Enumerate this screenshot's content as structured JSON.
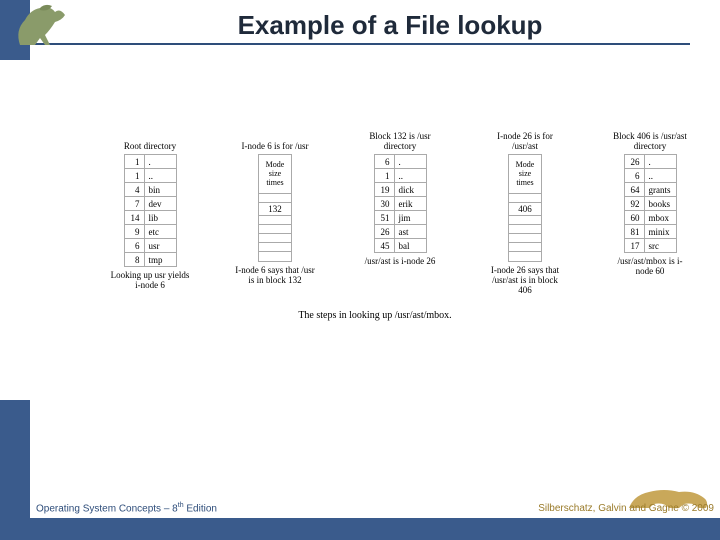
{
  "title": "Example of a File lookup",
  "footer_left_a": "Operating System Concepts – 8",
  "footer_left_sup": "th",
  "footer_left_b": " Edition",
  "footer_right": "Silberschatz, Galvin and Gagne © 2009",
  "columns": {
    "root": {
      "header": "Root directory",
      "rows": [
        {
          "n": "1",
          "name": "."
        },
        {
          "n": "1",
          "name": ".."
        },
        {
          "n": "4",
          "name": "bin"
        },
        {
          "n": "7",
          "name": "dev"
        },
        {
          "n": "14",
          "name": "lib"
        },
        {
          "n": "9",
          "name": "etc"
        },
        {
          "n": "6",
          "name": "usr"
        },
        {
          "n": "8",
          "name": "tmp"
        }
      ],
      "caption": "Looking up usr yields i-node 6"
    },
    "inode6": {
      "header": "I-node 6 is for /usr",
      "body": "Mode size times",
      "pointer": "132",
      "caption": "I-node 6 says that /usr is in block 132"
    },
    "block132": {
      "header": "Block 132 is /usr directory",
      "rows": [
        {
          "n": "6",
          "name": "."
        },
        {
          "n": "1",
          "name": ".."
        },
        {
          "n": "19",
          "name": "dick"
        },
        {
          "n": "30",
          "name": "erik"
        },
        {
          "n": "51",
          "name": "jim"
        },
        {
          "n": "26",
          "name": "ast"
        },
        {
          "n": "45",
          "name": "bal"
        }
      ],
      "caption": "/usr/ast is i-node 26"
    },
    "inode26": {
      "header": "I-node 26 is for /usr/ast",
      "body": "Mode size times",
      "pointer": "406",
      "caption": "I-node 26 says that /usr/ast is in block 406"
    },
    "block406": {
      "header": "Block 406 is /usr/ast directory",
      "rows": [
        {
          "n": "26",
          "name": "."
        },
        {
          "n": "6",
          "name": ".."
        },
        {
          "n": "64",
          "name": "grants"
        },
        {
          "n": "92",
          "name": "books"
        },
        {
          "n": "60",
          "name": "mbox"
        },
        {
          "n": "81",
          "name": "minix"
        },
        {
          "n": "17",
          "name": "src"
        }
      ],
      "caption": "/usr/ast/mbox is i-node 60"
    }
  },
  "main_caption": "The steps in looking up /usr/ast/mbox."
}
